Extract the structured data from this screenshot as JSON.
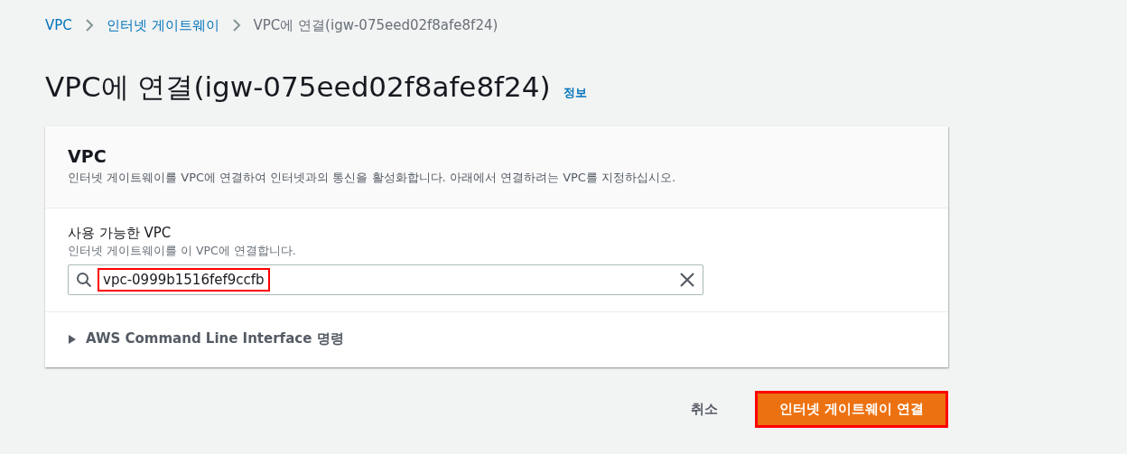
{
  "breadcrumb": [
    {
      "label": "VPC",
      "link": true
    },
    {
      "label": "인터넷 게이트웨이",
      "link": true
    },
    {
      "label": "VPC에 연결(igw-075eed02f8afe8f24)",
      "link": false
    }
  ],
  "page": {
    "title": "VPC에 연결(igw-075eed02f8afe8f24)",
    "info_link": "정보"
  },
  "card": {
    "title": "VPC",
    "description": "인터넷 게이트웨이를 VPC에 연결하여 인터넷과의 통신을 활성화합니다. 아래에서 연결하려는 VPC를 지정하십시오.",
    "field": {
      "label": "사용 가능한 VPC",
      "hint": "인터넷 게이트웨이를 이 VPC에 연결합니다.",
      "value": "vpc-0999b1516fef9ccfb",
      "highlighted": true
    },
    "expander": {
      "label": "AWS Command Line Interface 명령",
      "expanded": false
    }
  },
  "actions": [
    {
      "label": "취소",
      "kind": "link",
      "highlighted": false
    },
    {
      "label": "인터넷 게이트웨이 연결",
      "kind": "primary",
      "highlighted": true
    }
  ]
}
